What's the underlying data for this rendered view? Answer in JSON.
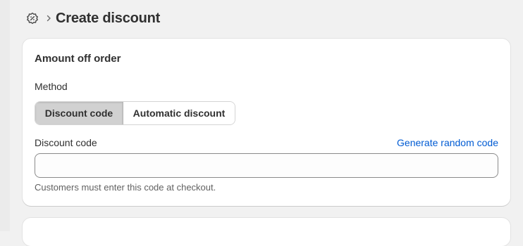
{
  "header": {
    "icon": "discount-gear-icon",
    "separator_icon": "chevron-right-icon",
    "title": "Create discount"
  },
  "card": {
    "title": "Amount off order",
    "method": {
      "label": "Method",
      "options": [
        "Discount code",
        "Automatic discount"
      ],
      "selected": "Discount code"
    },
    "code": {
      "label": "Discount code",
      "generate_link": "Generate random code",
      "value": "",
      "placeholder": "",
      "help": "Customers must enter this code at checkout."
    }
  },
  "colors": {
    "background": "#f1f1f1",
    "card": "#ffffff",
    "link": "#005bd3",
    "selected_segment": "#d1d1d1"
  }
}
